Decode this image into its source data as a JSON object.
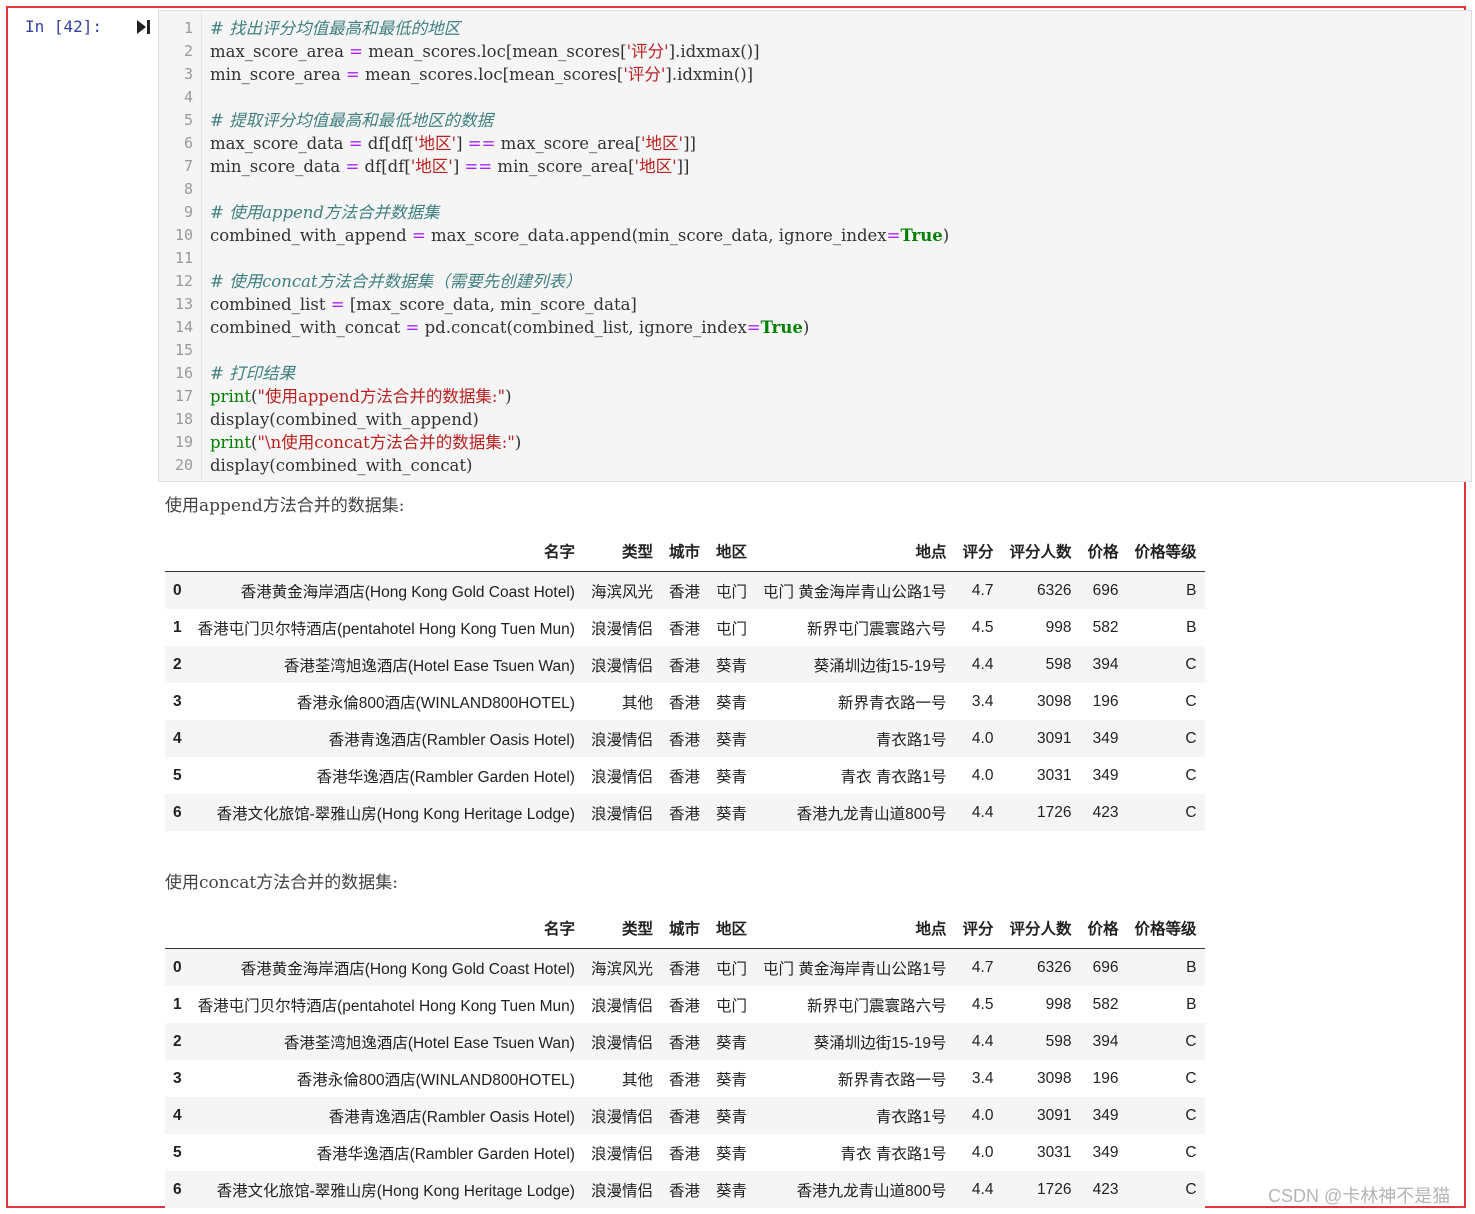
{
  "cell": {
    "prompt": "In  [42]:",
    "code_lines": [
      {
        "n": "1",
        "parts": [
          {
            "t": "# 找出评分均值最高和最低的地区",
            "c": "cm"
          }
        ]
      },
      {
        "n": "2",
        "parts": [
          {
            "t": "max_score_area ",
            "c": ""
          },
          {
            "t": "=",
            "c": "op"
          },
          {
            "t": " mean_scores.loc[mean_scores[",
            "c": ""
          },
          {
            "t": "'评分'",
            "c": "st"
          },
          {
            "t": "].idxmax()]",
            "c": ""
          }
        ]
      },
      {
        "n": "3",
        "parts": [
          {
            "t": "min_score_area ",
            "c": ""
          },
          {
            "t": "=",
            "c": "op"
          },
          {
            "t": " mean_scores.loc[mean_scores[",
            "c": ""
          },
          {
            "t": "'评分'",
            "c": "st"
          },
          {
            "t": "].idxmin()]",
            "c": ""
          }
        ]
      },
      {
        "n": "4",
        "parts": []
      },
      {
        "n": "5",
        "parts": [
          {
            "t": "# 提取评分均值最高和最低地区的数据",
            "c": "cm"
          }
        ]
      },
      {
        "n": "6",
        "parts": [
          {
            "t": "max_score_data ",
            "c": ""
          },
          {
            "t": "=",
            "c": "op"
          },
          {
            "t": " df[df[",
            "c": ""
          },
          {
            "t": "'地区'",
            "c": "st"
          },
          {
            "t": "] ",
            "c": ""
          },
          {
            "t": "==",
            "c": "op"
          },
          {
            "t": " max_score_area[",
            "c": ""
          },
          {
            "t": "'地区'",
            "c": "st"
          },
          {
            "t": "]]",
            "c": ""
          }
        ]
      },
      {
        "n": "7",
        "parts": [
          {
            "t": "min_score_data ",
            "c": ""
          },
          {
            "t": "=",
            "c": "op"
          },
          {
            "t": " df[df[",
            "c": ""
          },
          {
            "t": "'地区'",
            "c": "st"
          },
          {
            "t": "] ",
            "c": ""
          },
          {
            "t": "==",
            "c": "op"
          },
          {
            "t": " min_score_area[",
            "c": ""
          },
          {
            "t": "'地区'",
            "c": "st"
          },
          {
            "t": "]]",
            "c": ""
          }
        ]
      },
      {
        "n": "8",
        "parts": []
      },
      {
        "n": "9",
        "parts": [
          {
            "t": "# 使用append方法合并数据集",
            "c": "cm"
          }
        ]
      },
      {
        "n": "10",
        "parts": [
          {
            "t": "combined_with_append ",
            "c": ""
          },
          {
            "t": "=",
            "c": "op"
          },
          {
            "t": " max_score_data.append(min_score_data, ignore_index",
            "c": ""
          },
          {
            "t": "=",
            "c": "op"
          },
          {
            "t": "True",
            "c": "kw"
          },
          {
            "t": ")",
            "c": ""
          }
        ]
      },
      {
        "n": "11",
        "parts": []
      },
      {
        "n": "12",
        "parts": [
          {
            "t": "# 使用concat方法合并数据集（需要先创建列表）",
            "c": "cm"
          }
        ]
      },
      {
        "n": "13",
        "parts": [
          {
            "t": "combined_list ",
            "c": ""
          },
          {
            "t": "=",
            "c": "op"
          },
          {
            "t": " [max_score_data, min_score_data]",
            "c": ""
          }
        ]
      },
      {
        "n": "14",
        "parts": [
          {
            "t": "combined_with_concat ",
            "c": ""
          },
          {
            "t": "=",
            "c": "op"
          },
          {
            "t": " pd.concat(combined_list, ignore_index",
            "c": ""
          },
          {
            "t": "=",
            "c": "op"
          },
          {
            "t": "True",
            "c": "kw"
          },
          {
            "t": ")",
            "c": ""
          }
        ]
      },
      {
        "n": "15",
        "parts": []
      },
      {
        "n": "16",
        "parts": [
          {
            "t": "# 打印结果",
            "c": "cm"
          }
        ]
      },
      {
        "n": "17",
        "parts": [
          {
            "t": "print",
            "c": "bi"
          },
          {
            "t": "(",
            "c": ""
          },
          {
            "t": "\"使用append方法合并的数据集:\"",
            "c": "st"
          },
          {
            "t": ")",
            "c": ""
          }
        ]
      },
      {
        "n": "18",
        "parts": [
          {
            "t": "display(combined_with_append)",
            "c": ""
          }
        ]
      },
      {
        "n": "19",
        "parts": [
          {
            "t": "print",
            "c": "bi"
          },
          {
            "t": "(",
            "c": ""
          },
          {
            "t": "\"\\n使用concat方法合并的数据集:\"",
            "c": "st"
          },
          {
            "t": ")",
            "c": ""
          }
        ]
      },
      {
        "n": "20",
        "parts": [
          {
            "t": "display(combined_with_concat)",
            "c": ""
          }
        ]
      }
    ]
  },
  "output": {
    "text1": "使用append方法合并的数据集:",
    "text2": "使用concat方法合并的数据集:",
    "columns": [
      "",
      "名字",
      "类型",
      "城市",
      "地区",
      "地点",
      "评分",
      "评分人数",
      "价格",
      "价格等级"
    ],
    "rows": [
      [
        "0",
        "香港黄金海岸酒店(Hong Kong Gold Coast Hotel)",
        "海滨风光",
        "香港",
        "屯门",
        "屯门 黄金海岸青山公路1号",
        "4.7",
        "6326",
        "696",
        "B"
      ],
      [
        "1",
        "香港屯门贝尔特酒店(pentahotel Hong Kong Tuen Mun)",
        "浪漫情侣",
        "香港",
        "屯门",
        "新界屯门震寰路六号",
        "4.5",
        "998",
        "582",
        "B"
      ],
      [
        "2",
        "香港荃湾旭逸酒店(Hotel Ease Tsuen Wan)",
        "浪漫情侣",
        "香港",
        "葵青",
        "葵涌圳边街15-19号",
        "4.4",
        "598",
        "394",
        "C"
      ],
      [
        "3",
        "香港永倫800酒店(WINLAND800HOTEL)",
        "其他",
        "香港",
        "葵青",
        "新界青衣路一号",
        "3.4",
        "3098",
        "196",
        "C"
      ],
      [
        "4",
        "香港青逸酒店(Rambler Oasis Hotel)",
        "浪漫情侣",
        "香港",
        "葵青",
        "青衣路1号",
        "4.0",
        "3091",
        "349",
        "C"
      ],
      [
        "5",
        "香港华逸酒店(Rambler Garden Hotel)",
        "浪漫情侣",
        "香港",
        "葵青",
        "青衣 青衣路1号",
        "4.0",
        "3031",
        "349",
        "C"
      ],
      [
        "6",
        "香港文化旅馆-翠雅山房(Hong Kong Heritage Lodge)",
        "浪漫情侣",
        "香港",
        "葵青",
        "香港九龙青山道800号",
        "4.4",
        "1726",
        "423",
        "C"
      ]
    ]
  },
  "watermark": "CSDN @卡林神不是猫"
}
